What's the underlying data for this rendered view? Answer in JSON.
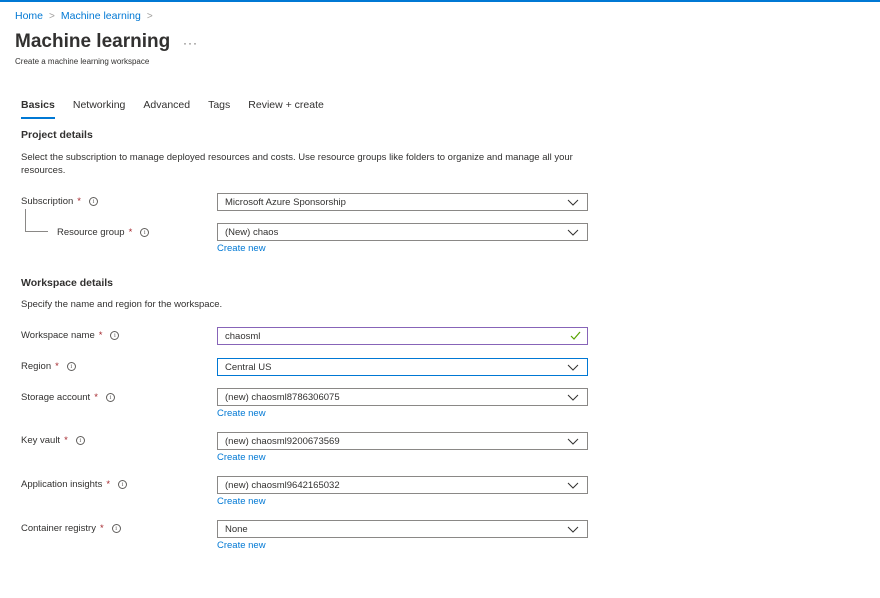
{
  "breadcrumb": {
    "items": [
      "Home",
      "Machine learning"
    ],
    "separator": ">"
  },
  "page": {
    "title": "Machine learning",
    "more": "···",
    "subtitle": "Create a machine learning workspace"
  },
  "tabs": [
    {
      "label": "Basics",
      "active": true
    },
    {
      "label": "Networking",
      "active": false
    },
    {
      "label": "Advanced",
      "active": false
    },
    {
      "label": "Tags",
      "active": false
    },
    {
      "label": "Review + create",
      "active": false
    }
  ],
  "project": {
    "heading": "Project details",
    "description": "Select the subscription to manage deployed resources and costs. Use resource groups like folders to organize and manage all your resources.",
    "subscription": {
      "label": "Subscription",
      "value": "Microsoft Azure Sponsorship"
    },
    "resource_group": {
      "label": "Resource group",
      "value": "(New) chaos",
      "link": "Create new"
    }
  },
  "workspace": {
    "heading": "Workspace details",
    "description": "Specify the name and region for the workspace.",
    "name": {
      "label": "Workspace name",
      "value": "chaosml"
    },
    "region": {
      "label": "Region",
      "value": "Central US"
    },
    "storage": {
      "label": "Storage account",
      "value": "(new) chaosml8786306075",
      "link": "Create new"
    },
    "keyvault": {
      "label": "Key vault",
      "value": "(new) chaosml9200673569",
      "link": "Create new"
    },
    "insights": {
      "label": "Application insights",
      "value": "(new) chaosml9642165032",
      "link": "Create new"
    },
    "registry": {
      "label": "Container registry",
      "value": "None",
      "link": "Create new"
    }
  },
  "common": {
    "required": "*",
    "info": "i"
  },
  "colors": {
    "accent": "#0078d4",
    "required": "#a4262c",
    "valid": "#8764b8",
    "check": "#57a300"
  }
}
